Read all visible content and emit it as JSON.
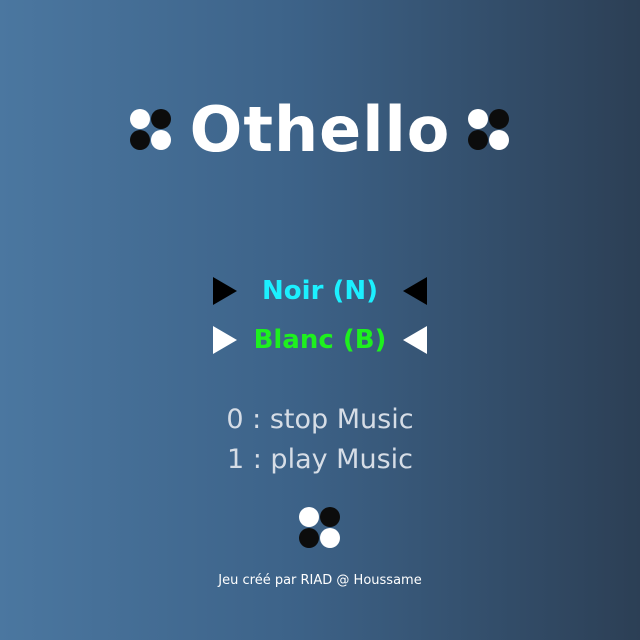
{
  "title": "Othello",
  "menu": {
    "noir_label": "Noir (N)",
    "blanc_label": "Blanc (B)"
  },
  "music": {
    "stop_label": "0 : stop Music",
    "play_label": "1 : play Music"
  },
  "footer": "Jeu créé par RIAD @ Houssame",
  "colors": {
    "background_start": "#4b77a0",
    "background_end": "#2c3f55",
    "noir_text": "#1cf0ff",
    "blanc_text": "#1ef01e",
    "music_text": "#d6dde6"
  },
  "icons": {
    "disc_cluster": "othello-discs-icon",
    "selector_left": "triangle-right-icon",
    "selector_right": "triangle-left-icon"
  }
}
